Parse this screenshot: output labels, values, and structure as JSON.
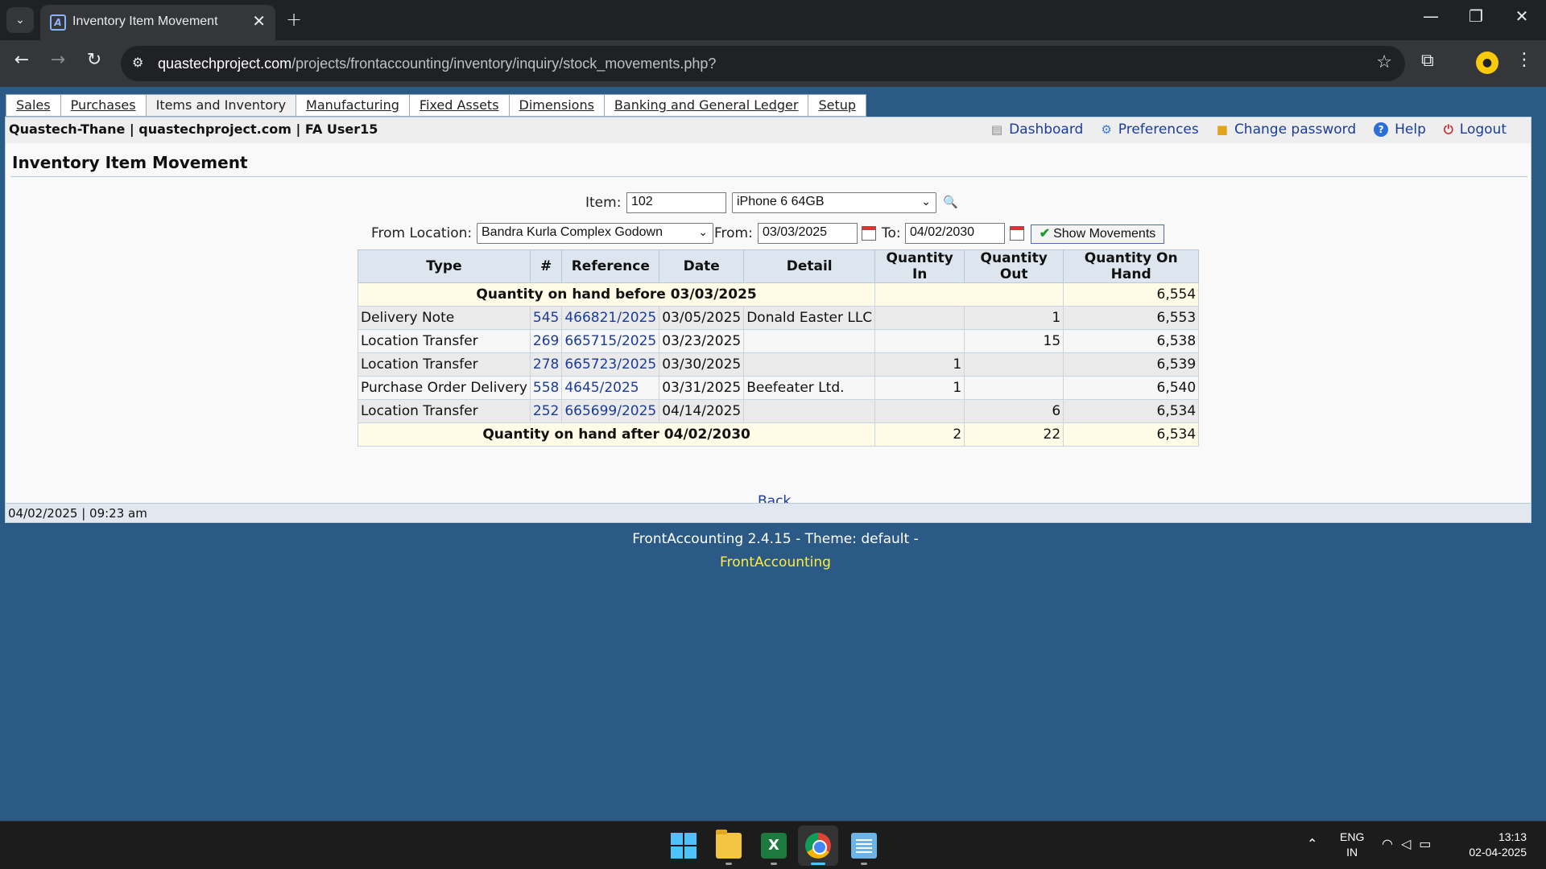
{
  "browser": {
    "tab_title": "Inventory Item Movement",
    "url_host": "quastechproject.com",
    "url_path": "/projects/frontaccounting/inventory/inquiry/stock_movements.php?"
  },
  "modules": [
    "Sales",
    "Purchases",
    "Items and Inventory",
    "Manufacturing",
    "Fixed Assets",
    "Dimensions",
    "Banking and General Ledger",
    "Setup"
  ],
  "header": {
    "company": "Quastech-Thane | quastechproject.com | FA User15",
    "links": [
      "Dashboard",
      "Preferences",
      "Change password",
      "Help",
      "Logout"
    ]
  },
  "page": {
    "title": "Inventory Item Movement"
  },
  "filters": {
    "item_label": "Item:",
    "item_code": "102",
    "item_name": "iPhone 6 64GB",
    "location_label": "From Location:",
    "location": "Bandra Kurla Complex Godown",
    "from_label": "From:",
    "from_date": "03/03/2025",
    "to_label": "To:",
    "to_date": "04/02/2030",
    "show_button": "Show Movements"
  },
  "table": {
    "headers": [
      "Type",
      "#",
      "Reference",
      "Date",
      "Detail",
      "Quantity In",
      "Quantity Out",
      "Quantity On Hand"
    ],
    "before": {
      "label": "Quantity on hand before 03/03/2025",
      "on_hand": "6,554"
    },
    "rows": [
      {
        "type": "Delivery Note",
        "no": "545",
        "ref": "466821/2025",
        "date": "03/05/2025",
        "detail": "Donald Easter LLC",
        "qin": "",
        "qout": "1",
        "onhand": "6,553"
      },
      {
        "type": "Location Transfer",
        "no": "269",
        "ref": "665715/2025",
        "date": "03/23/2025",
        "detail": "",
        "qin": "",
        "qout": "15",
        "onhand": "6,538"
      },
      {
        "type": "Location Transfer",
        "no": "278",
        "ref": "665723/2025",
        "date": "03/30/2025",
        "detail": "",
        "qin": "1",
        "qout": "",
        "onhand": "6,539"
      },
      {
        "type": "Purchase Order Delivery",
        "no": "558",
        "ref": "4645/2025",
        "date": "03/31/2025",
        "detail": "Beefeater Ltd.",
        "qin": "1",
        "qout": "",
        "onhand": "6,540"
      },
      {
        "type": "Location Transfer",
        "no": "252",
        "ref": "665699/2025",
        "date": "04/14/2025",
        "detail": "",
        "qin": "",
        "qout": "6",
        "onhand": "6,534"
      }
    ],
    "after": {
      "label": "Quantity on hand after 04/02/2030",
      "qin": "2",
      "qout": "22",
      "on_hand": "6,534"
    }
  },
  "back_link": "Back",
  "status": "04/02/2025 | 09:23 am",
  "footer": {
    "version": "FrontAccounting 2.4.15 - Theme: default -",
    "brand": "FrontAccounting"
  },
  "taskbar": {
    "lang1": "ENG",
    "lang2": "IN",
    "time": "13:13",
    "date": "02-04-2025"
  }
}
